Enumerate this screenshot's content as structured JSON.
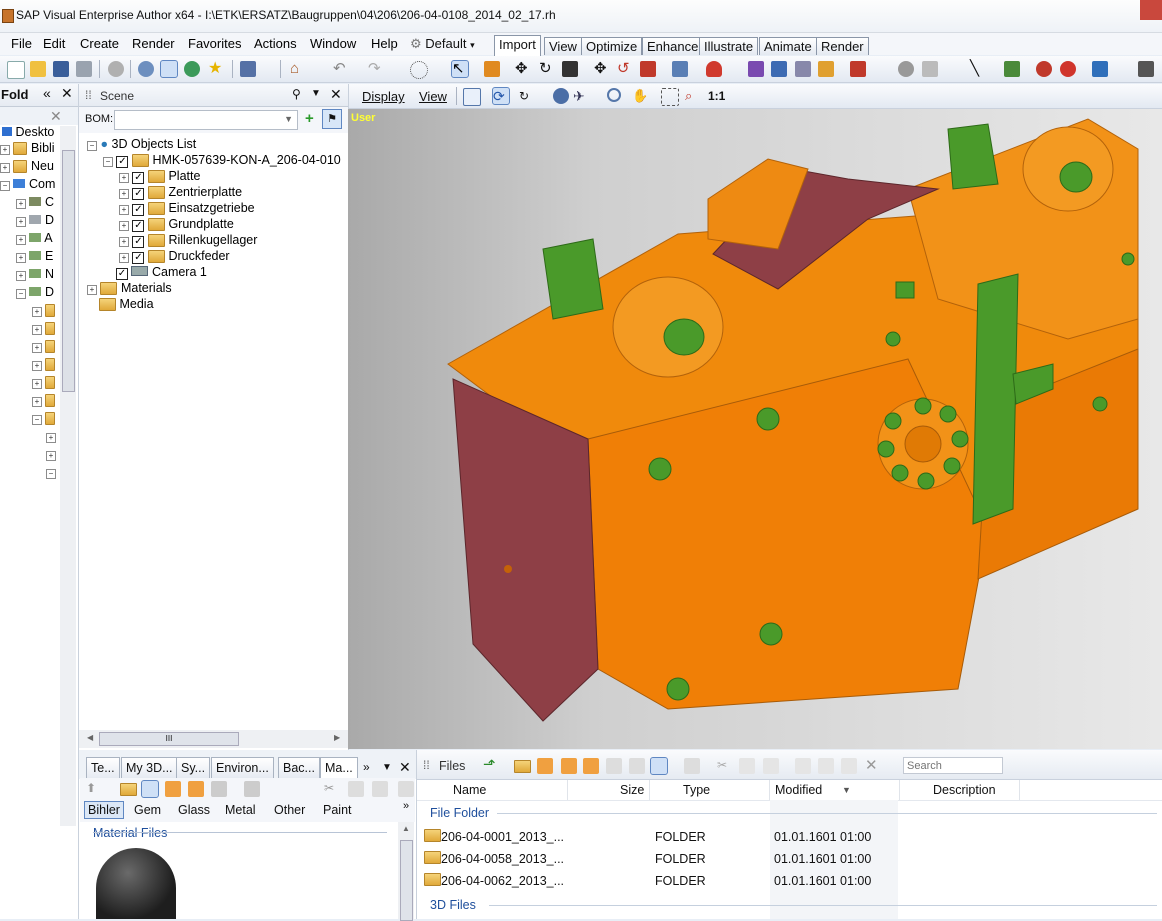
{
  "window": {
    "title": "SAP Visual Enterprise Author x64 - I:\\ETK\\ERSATZ\\Baugruppen\\04\\206\\206-04-0108_2014_02_17.rh"
  },
  "menu": {
    "items": [
      "File",
      "Edit",
      "Create",
      "Render",
      "Favorites",
      "Actions",
      "Window",
      "Help"
    ],
    "default_label": "Default"
  },
  "ribbon_tabs": [
    "Import",
    "View",
    "Optimize",
    "Enhance",
    "Illustrate",
    "Animate",
    "Render"
  ],
  "folders_panel": {
    "title": "Fold",
    "items": [
      "Deskto",
      "Bibli",
      "Neu",
      "Com",
      "C",
      "D",
      "A",
      "E",
      "N",
      "D"
    ]
  },
  "scene_panel": {
    "title": "Scene",
    "bom_label": "BOM:",
    "display_label": "Display",
    "view_label": "View",
    "zoom_label": "1:1",
    "tree": {
      "root": "3D Objects List",
      "assembly": "HMK-057639-KON-A_206-04-010",
      "parts": [
        "Platte",
        "Zentrierplatte",
        "Einsatzgetriebe",
        "Grundplatte",
        "Rillenkugellager",
        "Druckfeder"
      ],
      "camera": "Camera 1",
      "materials": "Materials",
      "media": "Media"
    },
    "scroll_mark": "III"
  },
  "viewport": {
    "camera_label": "User"
  },
  "materials_panel": {
    "tabs": [
      "Te...",
      "My 3D...",
      "Sy...",
      "Environ...",
      "Bac...",
      "Ma..."
    ],
    "categories": [
      "Bihler",
      "Gem",
      "Glass",
      "Metal",
      "Other",
      "Paint"
    ],
    "section_title": "Material Files"
  },
  "files_panel": {
    "title": "Files",
    "search_placeholder": "Search",
    "columns": [
      "Name",
      "Size",
      "Type",
      "Modified",
      "Description"
    ],
    "group_folder": "File Folder",
    "group_3d": "3D Files",
    "rows": [
      {
        "name": "206-04-0001_2013_...",
        "type": "FOLDER",
        "modified": "01.01.1601 01:00"
      },
      {
        "name": "206-04-0058_2013_...",
        "type": "FOLDER",
        "modified": "01.01.1601 01:00"
      },
      {
        "name": "206-04-0062_2013_...",
        "type": "FOLDER",
        "modified": "01.01.1601 01:00"
      }
    ]
  },
  "colors": {
    "orange": "#f08a0c",
    "maroon": "#8e3f46",
    "green": "#4a9a2a",
    "accent": "#316ac5"
  }
}
